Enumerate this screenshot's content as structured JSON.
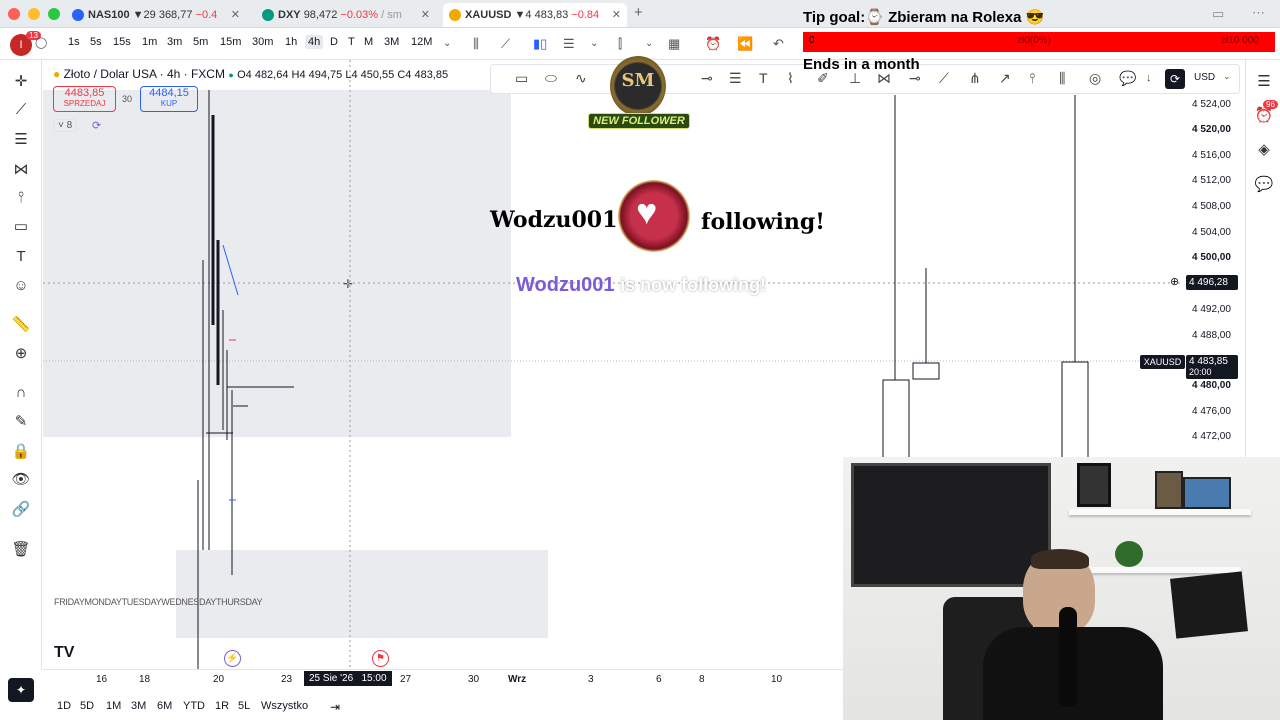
{
  "browser": {
    "tabs": [
      {
        "title": "NAS100",
        "price": "29 368,77",
        "change": "−0.4",
        "active": false
      },
      {
        "title": "DXY",
        "price": "98,472",
        "change": "−0.03%",
        "suffix": "/ sm",
        "active": false
      },
      {
        "title": "XAUUSD",
        "price": "4 483,83",
        "change": "−0.84",
        "active": true
      }
    ],
    "new_tab": "+"
  },
  "toolbar": {
    "avatar_badge": "13",
    "timeframes": [
      "1s",
      "5s",
      "15s",
      "1m",
      "3m",
      "5m",
      "15m",
      "30m",
      "1h",
      "4h",
      "D",
      "T",
      "M",
      "3M",
      "12M"
    ],
    "selected_timeframe": "4h"
  },
  "legend": {
    "symbol": "Złoto / Dolar USA · 4h · FXCM",
    "ohlc": "O4 482,64 H4 494,75 L4 450,55 C4 483,85",
    "sell_price": "4483,85",
    "sell_label": "SPRZEDAJ",
    "spread": "30",
    "buy_price": "4484,15",
    "buy_label": "KUP",
    "indicators_count": "8"
  },
  "price_axis": {
    "currency": "USD",
    "labels": [
      "4 524,00",
      "4 520,00",
      "4 516,00",
      "4 512,00",
      "4 508,00",
      "4 504,00",
      "4 500,00",
      "4 496,28",
      "4 492,00",
      "4 488,00",
      "4 480,00",
      "4 476,00",
      "4 472,00"
    ],
    "crosshair_price": "4 496,28",
    "symbol_tag": "XAUUSD",
    "last_price": "4 483,85",
    "countdown": "20:00",
    "alert_badge": "96"
  },
  "time_axis": {
    "labels": [
      "16",
      "18",
      "20",
      "23",
      "27",
      "30",
      "Wrz",
      "3",
      "6",
      "8",
      "10"
    ],
    "crosshair_time": "25 Sie '26   15:00",
    "day_labels": "FRIDAYMONDAYTUESDAYWEDNESDAYTHURSDAY"
  },
  "range_buttons": [
    "1D",
    "5D",
    "1M",
    "3M",
    "6M",
    "YTD",
    "1R",
    "5L",
    "Wszystko"
  ],
  "overlay": {
    "tip_goal": "Tip goal:⌚ Zbieram na Rolexa 😎",
    "tip_left": "0",
    "tip_mid": "zł0(0%)",
    "tip_right": "zł10 000",
    "ends": "Ends in a month",
    "brand": "SM",
    "new_follower": "NEW FOLLOWER",
    "follower_big_left": "Wodzu001",
    "follower_big_right": "following!",
    "follower_name": "Wodzu001",
    "follower_suffix": "is now following!"
  },
  "colors": {
    "accent": "#2962ff",
    "sell": "#f23645",
    "buy": "#2962ff",
    "tip_bar": "#ff0000",
    "follower_purple": "#7b5cd6"
  }
}
